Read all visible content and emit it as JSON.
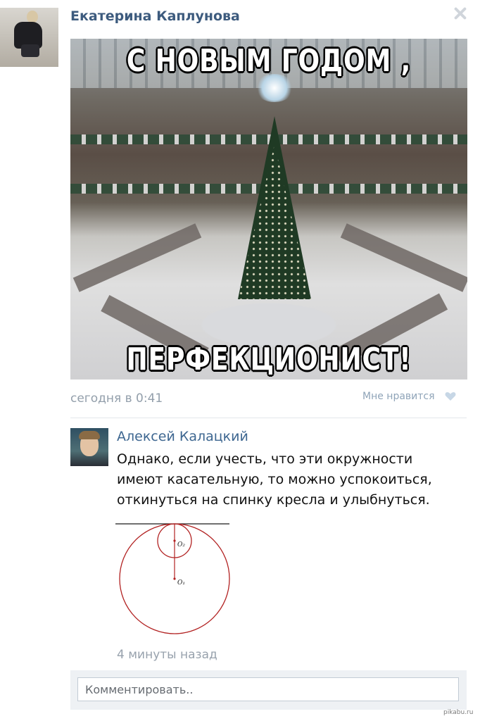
{
  "post": {
    "author": "Екатерина Каплунова",
    "image_top_text": "С НОВЫМ ГОДОМ ,",
    "image_bottom_text": "ПЕРФЕКЦИОНИСТ!",
    "date": "сегодня в 0:41",
    "like_label": "Мне нравится"
  },
  "comment": {
    "author": "Алексей Калацкий",
    "text": "Однако, если учесть, что эти окружности имеют касательную, то можно успокоиться, откинуться на спинку кресла и улыбнуться.",
    "diagram": {
      "label_small_center": "O₂",
      "label_big_center": "O₁"
    },
    "time": "4 минуты назад"
  },
  "reply": {
    "placeholder": "Комментировать.."
  },
  "watermark": "pikabu.ru",
  "colors": {
    "link": "#3d5b7e",
    "meta_gray": "#939fab",
    "diagram_red": "#b22222"
  },
  "icons": {
    "close": "close-icon",
    "like": "heart-icon"
  }
}
